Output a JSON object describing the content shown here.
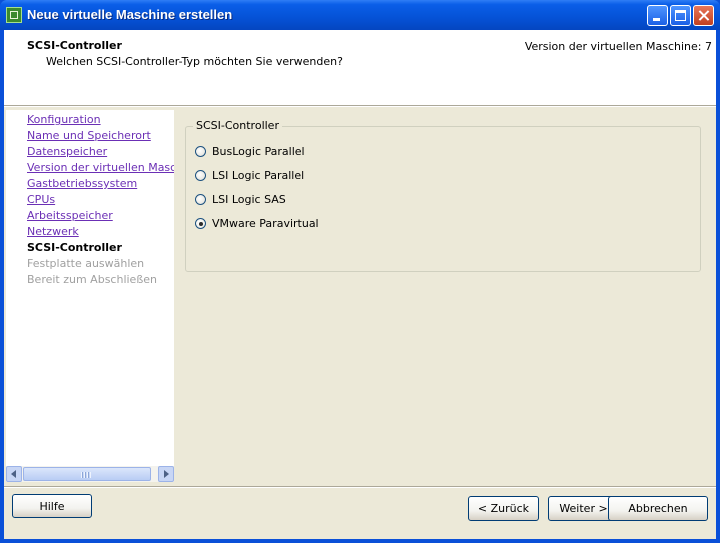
{
  "window": {
    "title": "Neue virtuelle Maschine erstellen"
  },
  "header": {
    "title": "SCSI-Controller",
    "subtitle": "Welchen SCSI-Controller-Typ möchten Sie verwenden?",
    "version": "Version der virtuellen Maschine: 7"
  },
  "nav": {
    "items": [
      {
        "label": "Konfiguration",
        "state": "link"
      },
      {
        "label": "Name und Speicherort",
        "state": "link"
      },
      {
        "label": "Datenspeicher",
        "state": "link"
      },
      {
        "label": "Version der virtuellen Maschine",
        "state": "link"
      },
      {
        "label": "Gastbetriebssystem",
        "state": "link"
      },
      {
        "label": "CPUs",
        "state": "link"
      },
      {
        "label": "Arbeitsspeicher",
        "state": "link"
      },
      {
        "label": "Netzwerk",
        "state": "link"
      },
      {
        "label": "SCSI-Controller",
        "state": "current"
      },
      {
        "label": "Festplatte auswählen",
        "state": "disabled"
      },
      {
        "label": "Bereit zum Abschließen",
        "state": "disabled"
      }
    ]
  },
  "group": {
    "legend": "SCSI-Controller",
    "options": [
      {
        "label": "BusLogic Parallel",
        "checked": false
      },
      {
        "label": "LSI Logic Parallel",
        "checked": false
      },
      {
        "label": "LSI Logic SAS",
        "checked": false
      },
      {
        "label": "VMware Paravirtual",
        "checked": true
      }
    ]
  },
  "buttons": {
    "help": "Hilfe",
    "back": "< Zurück",
    "next": "Weiter >",
    "cancel": "Abbrechen"
  }
}
